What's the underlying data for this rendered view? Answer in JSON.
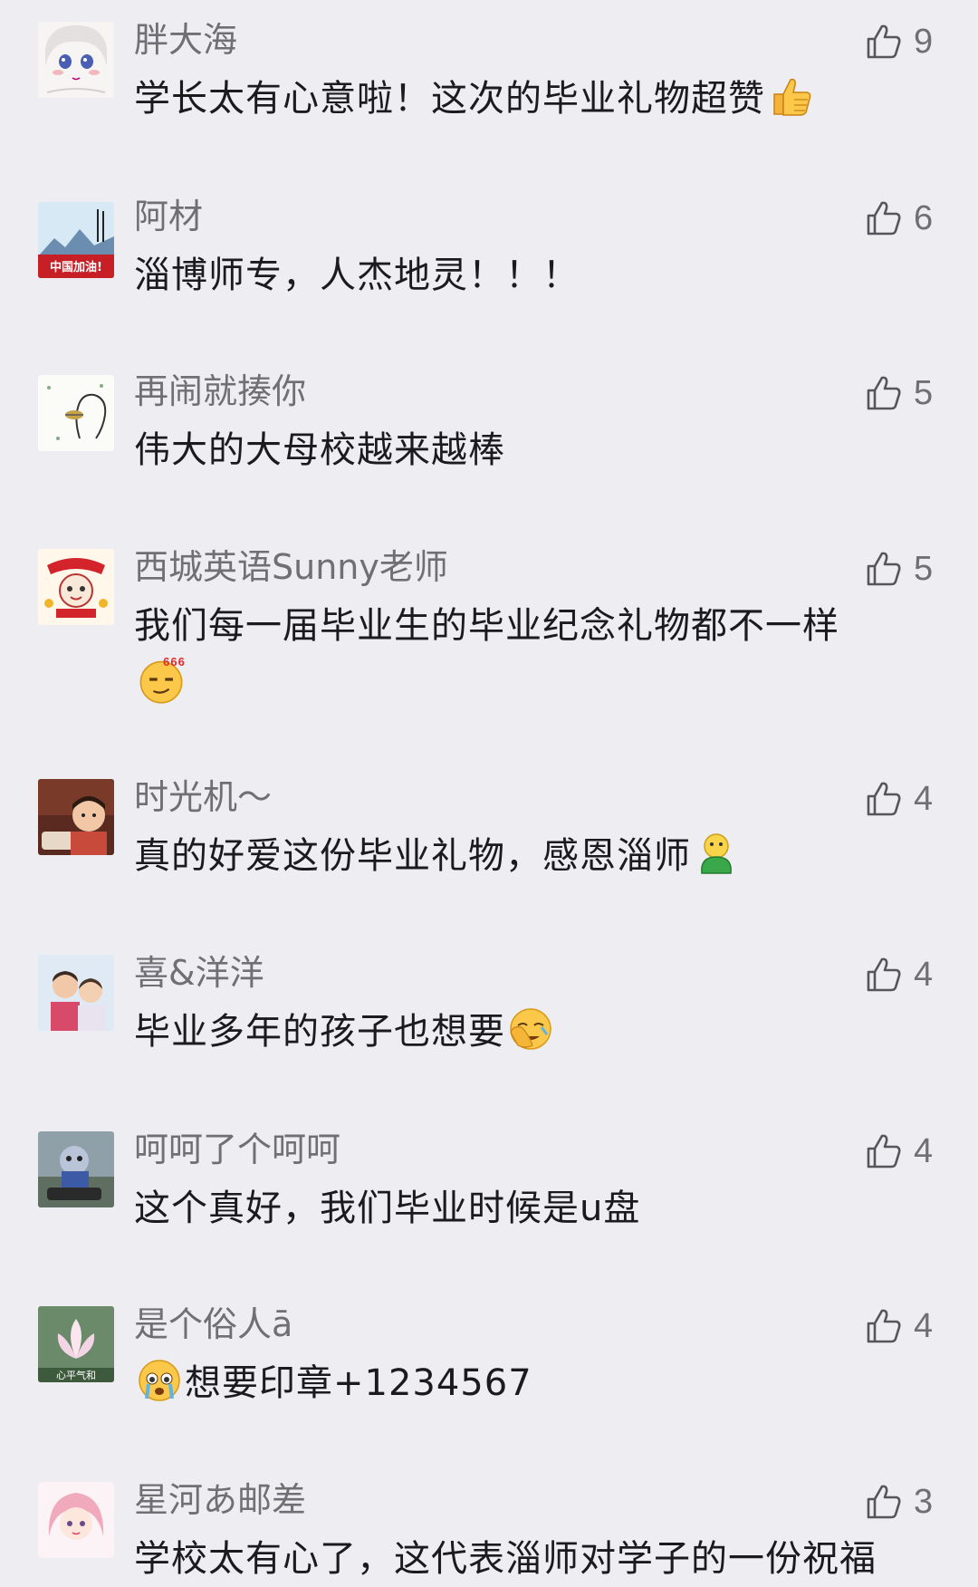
{
  "comments": [
    {
      "nickname": "胖大海",
      "text": "学长太有心意啦！这次的毕业礼物超赞",
      "emoji": "thumbs-up-emoji",
      "likes": "9",
      "avatar": "anime-face-avatar"
    },
    {
      "nickname": "阿材",
      "text": "淄博师专，人杰地灵！！！",
      "likes": "6",
      "avatar": "mountain-china-avatar",
      "avatar_text": "中国加油!"
    },
    {
      "nickname": "再闹就揍你",
      "text": "伟大的大母校越来越棒",
      "likes": "5",
      "avatar": "sketch-avatar"
    },
    {
      "nickname": "西城英语Sunny老师",
      "text": "我们每一届毕业生的毕业纪念礼物都不一样",
      "emoji_line": "666-emoji",
      "likes": "5",
      "avatar": "new-year-avatar"
    },
    {
      "nickname": "时光机～",
      "text": "真的好爱这份毕业礼物，感恩淄师",
      "emoji": "green-figure-emoji",
      "likes": "4",
      "avatar": "child-photo-avatar"
    },
    {
      "nickname": "喜&洋洋",
      "text": "毕业多年的孩子也想要",
      "emoji": "facepalm-emoji",
      "likes": "4",
      "avatar": "kids-photo-avatar"
    },
    {
      "nickname": "呵呵了个呵呵",
      "text": "这个真好，我们毕业时候是u盘",
      "likes": "4",
      "avatar": "cartoon-photo-avatar"
    },
    {
      "nickname": "是个俗人ā",
      "text": "想要印章+1234567",
      "emoji_lead": "crying-emoji",
      "likes": "4",
      "avatar": "lotus-avatar",
      "avatar_text": "心平气和"
    },
    {
      "nickname": "星河あ邮差",
      "text": "学校太有心了，这代表淄师对学子的一份祝福",
      "likes": "3",
      "avatar": "anime-girl-avatar"
    }
  ],
  "colors": {
    "background": "#ededf2",
    "nickname": "#6f6f75",
    "text": "#1b1b1d"
  }
}
